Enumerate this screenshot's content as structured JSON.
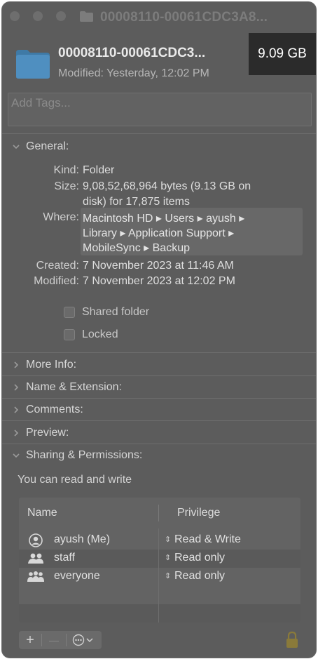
{
  "window": {
    "title": "00008110-00061CDC3A8..."
  },
  "header": {
    "name": "00008110-00061CDC3...",
    "modified": "Modified:  Yesterday, 12:02 PM",
    "size_badge": "9.09 GB",
    "icon": "folder-icon"
  },
  "tags": {
    "placeholder": "Add Tags..."
  },
  "general": {
    "label": "General:",
    "kind_label": "Kind:",
    "kind_value": "Folder",
    "size_label": "Size:",
    "size_line1": "9,08,52,68,964 bytes (9.13 GB on",
    "size_line2": "disk) for 17,875 items",
    "where_label": "Where:",
    "where_line1": "Macintosh HD ▸ Users ▸ ayush ▸",
    "where_line2": "Library ▸ Application Support ▸",
    "where_line3": "MobileSync ▸ Backup",
    "created_label": "Created:",
    "created_value": "7 November 2023 at 11:46 AM",
    "modified_label": "Modified:",
    "modified_value": "7 November 2023 at 12:02 PM",
    "shared_folder": "Shared folder",
    "locked": "Locked"
  },
  "sections": {
    "more_info": "More Info:",
    "name_extension": "Name & Extension:",
    "comments": "Comments:",
    "preview": "Preview:",
    "sharing_permissions": "Sharing & Permissions:"
  },
  "permissions": {
    "note": "You can read and write",
    "col_name": "Name",
    "col_privilege": "Privilege",
    "rows": [
      {
        "name": "ayush (Me)",
        "privilege": "Read & Write",
        "icon": "user-icon"
      },
      {
        "name": "staff",
        "privilege": "Read only",
        "icon": "group-icon"
      },
      {
        "name": "everyone",
        "privilege": "Read only",
        "icon": "everyone-icon"
      }
    ]
  },
  "toolbar": {
    "add": "+",
    "remove": "—",
    "action": "⋯"
  },
  "colors": {
    "window_bg": "#5c5c5c",
    "badge_bg": "#2b2b2b",
    "folder_blue": "#4a8ab8"
  }
}
